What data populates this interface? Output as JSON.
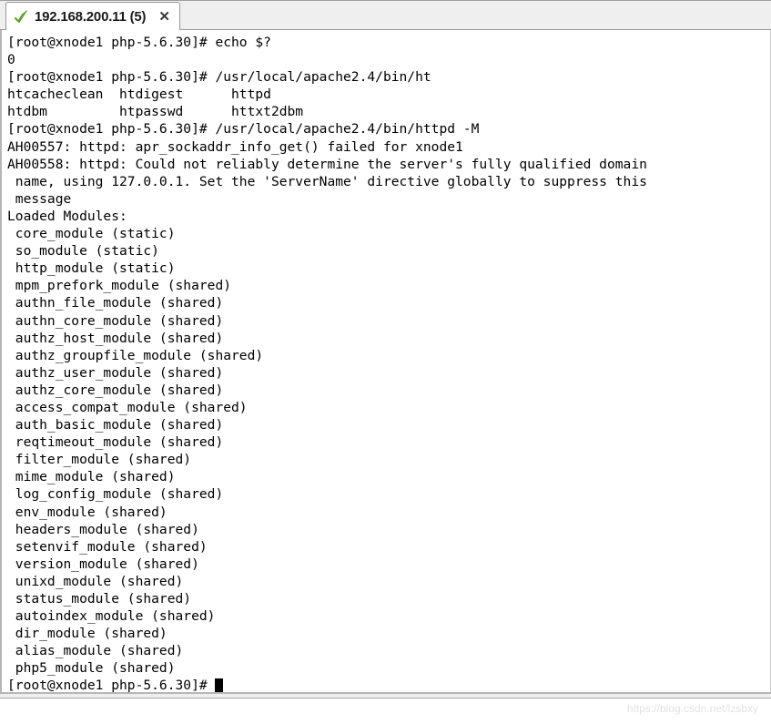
{
  "window": {
    "tab": {
      "status_icon": "green-check-icon",
      "title": "192.168.200.11 (5)",
      "close_label": "✕"
    }
  },
  "terminal": {
    "prompt": "[root@xnode1 php-5.6.30]#",
    "lines": [
      "[root@xnode1 php-5.6.30]# echo $?",
      "0",
      "[root@xnode1 php-5.6.30]# /usr/local/apache2.4/bin/ht",
      "htcacheclean  htdigest      httpd",
      "htdbm         htpasswd      httxt2dbm",
      "[root@xnode1 php-5.6.30]# /usr/local/apache2.4/bin/httpd -M",
      "AH00557: httpd: apr_sockaddr_info_get() failed for xnode1",
      "AH00558: httpd: Could not reliably determine the server's fully qualified domain",
      " name, using 127.0.0.1. Set the 'ServerName' directive globally to suppress this",
      " message",
      "Loaded Modules:",
      " core_module (static)",
      " so_module (static)",
      " http_module (static)",
      " mpm_prefork_module (shared)",
      " authn_file_module (shared)",
      " authn_core_module (shared)",
      " authz_host_module (shared)",
      " authz_groupfile_module (shared)",
      " authz_user_module (shared)",
      " authz_core_module (shared)",
      " access_compat_module (shared)",
      " auth_basic_module (shared)",
      " reqtimeout_module (shared)",
      " filter_module (shared)",
      " mime_module (shared)",
      " log_config_module (shared)",
      " env_module (shared)",
      " headers_module (shared)",
      " setenvif_module (shared)",
      " version_module (shared)",
      " unixd_module (shared)",
      " status_module (shared)",
      " autoindex_module (shared)",
      " dir_module (shared)",
      " alias_module (shared)",
      " php5_module (shared)"
    ],
    "final_prompt": "[root@xnode1 php-5.6.30]# "
  },
  "statusbar": {
    "watermark": "https://blog.csdn.net/lzsbxy"
  },
  "colors": {
    "terminal_bg": "#ffffff",
    "terminal_fg": "#000000",
    "chrome_bg": "#efefef",
    "check_green": "#5cb11f"
  }
}
